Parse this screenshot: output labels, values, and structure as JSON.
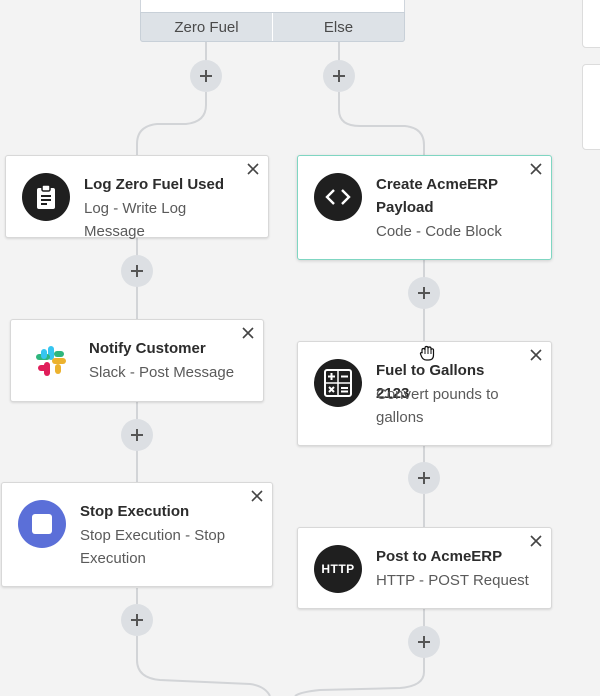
{
  "branch": {
    "tabs": [
      "Zero Fuel",
      "Else"
    ]
  },
  "left_column": [
    {
      "title": "Log Zero Fuel Used",
      "subtitle": "Log - Write Log Message",
      "icon": "clipboard-icon"
    },
    {
      "title": "Notify Customer",
      "subtitle": "Slack - Post Message",
      "icon": "slack-icon"
    },
    {
      "title": "Stop Execution",
      "subtitle": "Stop Execution - Stop Execution",
      "icon": "stop-icon"
    }
  ],
  "right_column": [
    {
      "title": "Create AcmeERP Payload",
      "subtitle": "Code - Code Block",
      "icon": "code-icon",
      "selected": true
    },
    {
      "title": "Fuel to Gallons 2123",
      "subtitle": "Convert pounds to gallons",
      "icon": "calculator-icon"
    },
    {
      "title": "Post to AcmeERP",
      "subtitle": "HTTP - POST Request",
      "icon": "http-icon",
      "icon_text": "HTTP"
    }
  ],
  "colors": {
    "background": "#f3f3f3",
    "selected_border": "#7fd6c2",
    "stop_icon": "#5b6fd8",
    "connector": "#d0d3d6"
  }
}
